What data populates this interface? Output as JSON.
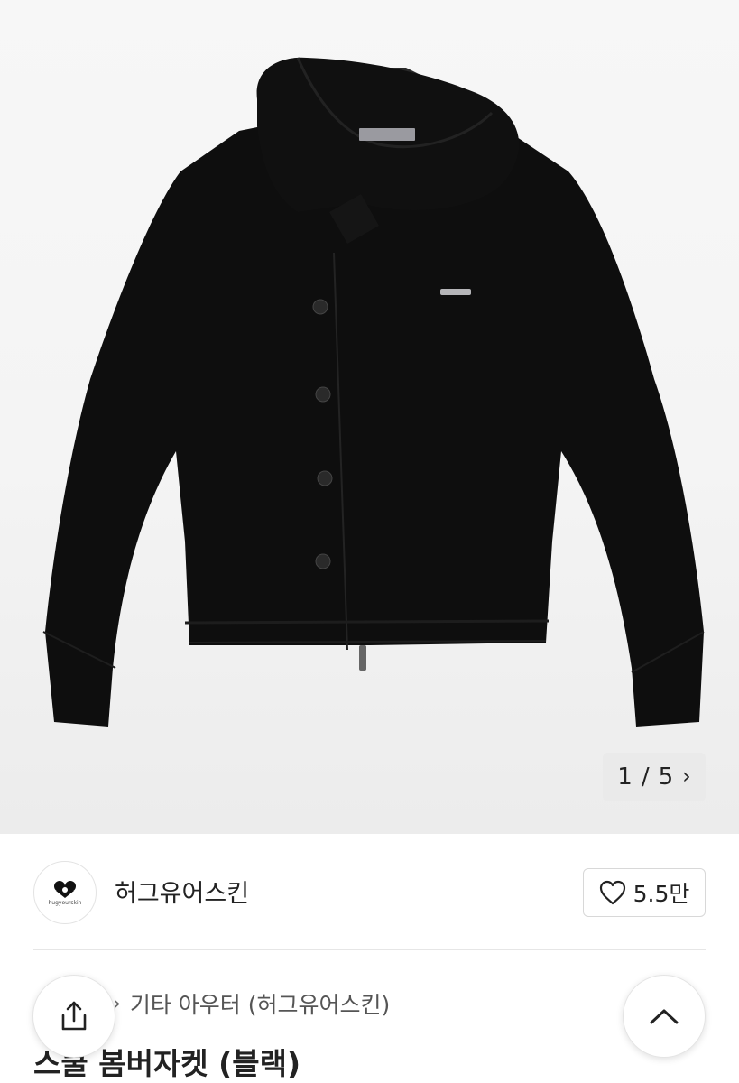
{
  "gallery": {
    "current_page": "1",
    "total_pages": "5",
    "pager_separator": "/",
    "next_glyph": "›"
  },
  "shop": {
    "name": "허그유어스킨",
    "logo_text": "hugyourskin",
    "like_count": "5.5만",
    "like_icon": "heart-outline-icon"
  },
  "product": {
    "breadcrumb": [
      "기타 아우터 (허그유어스킨)"
    ],
    "breadcrumb_separator": "›",
    "title": "스쿨 봄버자켓 (블랙)"
  },
  "floating": {
    "share_icon": "share-upload-icon",
    "scroll_top_icon": "chevron-up-icon"
  },
  "colors": {
    "background": "#ffffff",
    "image_bg": "#f4f4f4",
    "text": "#222222",
    "secondary_text": "#555555",
    "jacket": "#0d0d0d"
  }
}
